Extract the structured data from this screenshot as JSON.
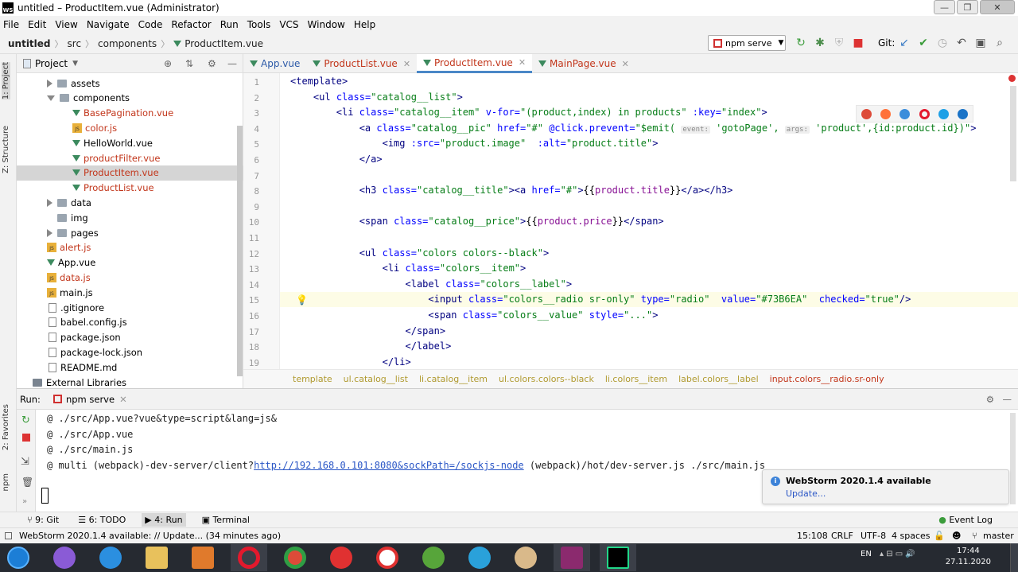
{
  "window": {
    "title": "untitled – ProductItem.vue (Administrator)",
    "app_icon": "WS"
  },
  "menu": [
    "File",
    "Edit",
    "View",
    "Navigate",
    "Code",
    "Refactor",
    "Run",
    "Tools",
    "VCS",
    "Window",
    "Help"
  ],
  "nav": {
    "crumbs": [
      "untitled",
      "src",
      "components",
      "ProductItem.vue"
    ],
    "run_config": "npm serve",
    "git_label": "Git:"
  },
  "left_tool_tabs": [
    "1: Project",
    "Z: Structure",
    "2: Favorites",
    "npm"
  ],
  "project": {
    "header": "Project",
    "tree": [
      {
        "name": "assets",
        "type": "folder",
        "expanded": false,
        "indent": 0
      },
      {
        "name": "components",
        "type": "folder",
        "expanded": true,
        "indent": 0
      },
      {
        "name": "BasePagination.vue",
        "type": "vue",
        "indent": 1,
        "red": true
      },
      {
        "name": "color.js",
        "type": "js",
        "indent": 1,
        "red": true
      },
      {
        "name": "HelloWorld.vue",
        "type": "vue",
        "indent": 1,
        "red": false
      },
      {
        "name": "productFilter.vue",
        "type": "vue",
        "indent": 1,
        "red": true
      },
      {
        "name": "ProductItem.vue",
        "type": "vue",
        "indent": 1,
        "red": true,
        "selected": true
      },
      {
        "name": "ProductList.vue",
        "type": "vue",
        "indent": 1,
        "red": true
      },
      {
        "name": "data",
        "type": "folder",
        "expanded": false,
        "indent": 0
      },
      {
        "name": "img",
        "type": "folder",
        "expanded": null,
        "indent": 0
      },
      {
        "name": "pages",
        "type": "folder",
        "expanded": false,
        "indent": 0
      },
      {
        "name": "alert.js",
        "type": "js",
        "indent": 0,
        "red": true
      },
      {
        "name": "App.vue",
        "type": "vue",
        "indent": 0,
        "red": false
      },
      {
        "name": "data.js",
        "type": "js",
        "indent": 0,
        "red": true
      },
      {
        "name": "main.js",
        "type": "js",
        "indent": 0,
        "red": false
      },
      {
        "name": ".gitignore",
        "type": "file",
        "indent": -1,
        "red": false
      },
      {
        "name": "babel.config.js",
        "type": "file",
        "indent": -1,
        "red": false
      },
      {
        "name": "package.json",
        "type": "file",
        "indent": -1,
        "red": false
      },
      {
        "name": "package-lock.json",
        "type": "file",
        "indent": -1,
        "red": false
      },
      {
        "name": "README.md",
        "type": "file",
        "indent": -1,
        "red": false
      },
      {
        "name": "External Libraries",
        "type": "lib",
        "indent": -2,
        "red": false
      }
    ]
  },
  "editor": {
    "tabs": [
      {
        "label": "App.vue",
        "active": false
      },
      {
        "label": "ProductList.vue",
        "active": false
      },
      {
        "label": "ProductItem.vue",
        "active": true
      },
      {
        "label": "MainPage.vue",
        "active": false
      }
    ],
    "lines": [
      {
        "n": "1",
        "html": "<span class=\"tg\">&lt;template&gt;</span>"
      },
      {
        "n": "2",
        "html": "    <span class=\"tg\">&lt;ul</span> <span class=\"at\">class=</span><span class=\"av\">\"catalog__list\"</span><span class=\"tg\">&gt;</span>"
      },
      {
        "n": "3",
        "html": "        <span class=\"tg\">&lt;li</span> <span class=\"at\">class=</span><span class=\"av\">\"catalog__item\"</span> <span class=\"at\">v-for=</span><span class=\"av\">\"(product,index) in products\"</span> <span class=\"at\">:key=</span><span class=\"av\">\"index\"</span><span class=\"tg\">&gt;</span>"
      },
      {
        "n": "4",
        "html": "            <span class=\"tg\">&lt;a</span> <span class=\"at\">class=</span><span class=\"av\">\"catalog__pic\"</span> <span class=\"at\">href=</span><span class=\"av\">\"#\"</span> <span class=\"at\">@click.prevent=</span><span class=\"av\">\"$emit( <span class=\"hint\">event:</span> 'gotoPage', <span class=\"hint\">args:</span> 'product',{id:product.id})\"</span><span class=\"tg\">&gt;</span>"
      },
      {
        "n": "5",
        "html": "                <span class=\"tg\">&lt;img</span> <span class=\"at\">:src=</span><span class=\"av\">\"product.image\"</span>  <span class=\"at\">:alt=</span><span class=\"av\">\"product.title\"</span><span class=\"tg\">&gt;</span>"
      },
      {
        "n": "6",
        "html": "            <span class=\"tg\">&lt;/a&gt;</span>"
      },
      {
        "n": "7",
        "html": ""
      },
      {
        "n": "8",
        "html": "            <span class=\"tg\">&lt;h3</span> <span class=\"at\">class=</span><span class=\"av\">\"catalog__title\"</span><span class=\"tg\">&gt;&lt;a</span> <span class=\"at\">href=</span><span class=\"av\">\"#\"</span><span class=\"tg\">&gt;</span>{{<span class=\"va\">product.title</span>}}<span class=\"tg\">&lt;/a&gt;&lt;/h3&gt;</span>"
      },
      {
        "n": "9",
        "html": ""
      },
      {
        "n": "10",
        "html": "            <span class=\"tg\">&lt;span</span> <span class=\"at\">class=</span><span class=\"av\">\"catalog__price\"</span><span class=\"tg\">&gt;</span>{{<span class=\"va\">product.price</span>}}<span class=\"tg\">&lt;/span&gt;</span>"
      },
      {
        "n": "11",
        "html": ""
      },
      {
        "n": "12",
        "html": "            <span class=\"tg\">&lt;ul</span> <span class=\"at\">class=</span><span class=\"av\">\"colors colors--black\"</span><span class=\"tg\">&gt;</span>"
      },
      {
        "n": "13",
        "html": "                <span class=\"tg\">&lt;li</span> <span class=\"at\">class=</span><span class=\"av\">\"colors__item\"</span><span class=\"tg\">&gt;</span>"
      },
      {
        "n": "14",
        "html": "                    <span class=\"tg\">&lt;label</span> <span class=\"at\">class=</span><span class=\"av\">\"colors__label\"</span><span class=\"tg\">&gt;</span>"
      },
      {
        "n": "15",
        "html": "                        <span class=\"tg\">&lt;input</span> <span class=\"at\">class=</span><span class=\"av\">\"colors__radio sr-only\"</span> <span class=\"at\">type=</span><span class=\"av\">\"radio\"</span>  <span class=\"at\">value=</span><span class=\"av\">\"#73B6EA\"</span>  <span class=\"at\">checked=</span><span class=\"av\">\"true\"</span><span class=\"tg\">/&gt;</span>"
      },
      {
        "n": "16",
        "html": "                        <span class=\"tg\">&lt;span</span> <span class=\"at\">class=</span><span class=\"av\">\"colors__value\"</span> <span class=\"at\">style=</span><span class=\"av\">\"...\"</span><span class=\"tg\">&gt;</span>"
      },
      {
        "n": "17",
        "html": "                    <span class=\"tg\">&lt;/span&gt;</span>"
      },
      {
        "n": "18",
        "html": "                    <span class=\"tg\">&lt;/label&gt;</span>"
      },
      {
        "n": "19",
        "html": "                <span class=\"tg\">&lt;/li&gt;</span>"
      }
    ],
    "breadcrumb": [
      "template",
      "ul.catalog__list",
      "li.catalog__item",
      "ul.colors.colors--black",
      "li.colors__item",
      "label.colors__label",
      "input.colors__radio.sr-only"
    ]
  },
  "run": {
    "label": "Run:",
    "config": "npm serve",
    "output": [
      "@ ./src/App.vue?vue&type=script&lang=js&",
      "@ ./src/App.vue",
      "@ ./src/main.js"
    ],
    "last_prefix": "@ multi (webpack)-dev-server/client?",
    "last_link": "http://192.168.0.101:8080&sockPath=/sockjs-node",
    "last_suffix": " (webpack)/hot/dev-server.js ./src/main.js"
  },
  "notification": {
    "title": "WebStorm 2020.1.4 available",
    "action": "Update..."
  },
  "bottom_tabs": [
    "9: Git",
    "6: TODO",
    "4: Run",
    "Terminal"
  ],
  "event_log": "Event Log",
  "status": {
    "message": "WebStorm 2020.1.4 available: // Update... (34 minutes ago)",
    "position": "15:108",
    "line_sep": "CRLF",
    "encoding": "UTF-8",
    "indent": "4 spaces",
    "branch": "master"
  },
  "taskbar": {
    "lang": "EN",
    "time": "17:44",
    "date": "27.11.2020"
  }
}
